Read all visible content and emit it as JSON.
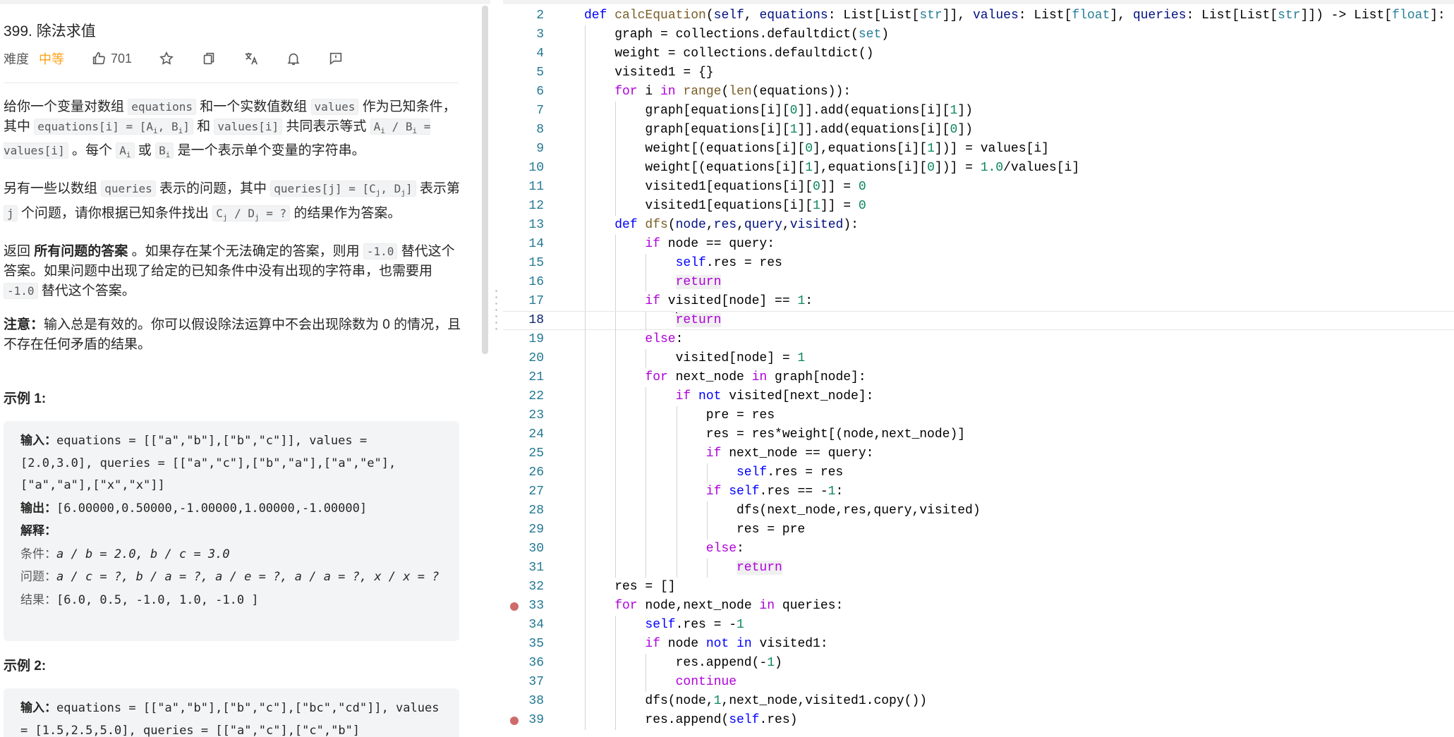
{
  "problem": {
    "title": "399. 除法求值",
    "difficulty_label": "难度",
    "difficulty": "中等",
    "likes": "701",
    "difficulty_color": "#ffa116",
    "icons": [
      "thumb-up-icon",
      "star-icon",
      "share-icon",
      "translate-icon",
      "bell-icon",
      "feedback-icon"
    ]
  },
  "description": {
    "p1_a": "给你一个变量对数组 ",
    "p1_code1": "equations",
    "p1_b": " 和一个实数值数组 ",
    "p1_code2": "values",
    "p1_c": " 作为已知条件，其中 ",
    "p1_code3": "equations[i] = [A",
    "p1_code3_sub1": "i",
    "p1_code3_mid": ", B",
    "p1_code3_sub2": "i",
    "p1_code3_end": "]",
    "p1_d": " 和 ",
    "p1_code4": "values[i]",
    "p1_e": " 共同表示等式 ",
    "p1_code5": "A",
    "p1_code5_sub": "i",
    "p1_code5_end": " / B",
    "p1_code5_sub2": "i",
    "p1_code5_tail": " = values[i]",
    "p1_f": " 。每个 ",
    "p1_code6": "A",
    "p1_code6_sub": "i",
    "p1_g": " 或 ",
    "p1_code7": "B",
    "p1_code7_sub": "i",
    "p1_h": " 是一个表示单个变量的字符串。",
    "p2_a": "另有一些以数组 ",
    "p2_code1": "queries",
    "p2_b": " 表示的问题，其中 ",
    "p2_code2": "queries[j] = [C",
    "p2_code2_sub1": "j",
    "p2_code2_mid": ", D",
    "p2_code2_sub2": "j",
    "p2_code2_end": "]",
    "p2_c": " 表示第 ",
    "p2_code3": "j",
    "p2_d": " 个问题，请你根据已知条件找出 ",
    "p2_code4": "C",
    "p2_code4_sub": "j",
    "p2_code4_mid": " / D",
    "p2_code4_sub2": "j",
    "p2_code4_end": " = ?",
    "p2_e": " 的结果作为答案。",
    "p3_a": "返回 ",
    "p3_bold": "所有问题的答案",
    "p3_b": " 。如果存在某个无法确定的答案，则用 ",
    "p3_code1": "-1.0",
    "p3_c": " 替代这个答案。如果问题中出现了给定的已知条件中没有出现的字符串，也需要用 ",
    "p3_code2": "-1.0",
    "p3_d": " 替代这个答案。",
    "p4_bold": "注意：",
    "p4_text": "输入总是有效的。你可以假设除法运算中不会出现除数为 0 的情况，且不存在任何矛盾的结果。"
  },
  "examples": [
    {
      "title": "示例 1:",
      "input_label": "输入：",
      "input": "equations = [[\"a\",\"b\"],[\"b\",\"c\"]], values = [2.0,3.0], queries = [[\"a\",\"c\"],[\"b\",\"a\"],[\"a\",\"e\"],[\"a\",\"a\"],[\"x\",\"x\"]]",
      "output_label": "输出：",
      "output": "[6.00000,0.50000,-1.00000,1.00000,-1.00000]",
      "explain_label": "解释：",
      "cond_label": "条件：",
      "cond": "a / b = 2.0, b / c = 3.0",
      "q_label": "问题：",
      "q": "a / c = ?, b / a = ?, a / e = ?, a / a = ?, x / x = ?",
      "res_label": "结果：",
      "res": "[6.0, 0.5, -1.0, 1.0, -1.0 ]"
    },
    {
      "title": "示例 2:",
      "input_label": "输入：",
      "input": "equations = [[\"a\",\"b\"],[\"b\",\"c\"],[\"bc\",\"cd\"]], values = [1.5,2.5,5.0], queries = [[\"a\",\"c\"],[\"c\",\"b\"]"
    }
  ],
  "editor": {
    "active_line": 18,
    "breakpoints": [
      33,
      39
    ],
    "lines": [
      {
        "n": 2,
        "indent": 1,
        "html": "<span class='kd'>def</span> <span class='fn'>calcEquation</span>(<span class='pr'>self</span>, <span class='pr'>equations</span>: List[List[<span class='bi'>str</span>]], <span class='pr'>values</span>: List[<span class='bi'>float</span>], <span class='pr'>queries</span>: List[List[<span class='bi'>str</span>]]) -> List[<span class='bi'>float</span>]:"
      },
      {
        "n": 3,
        "indent": 2,
        "html": "graph = collections.defaultdict(<span class='bi'>set</span>)"
      },
      {
        "n": 4,
        "indent": 2,
        "html": "weight = collections.defaultdict()"
      },
      {
        "n": 5,
        "indent": 2,
        "html": "visited1 = {}"
      },
      {
        "n": 6,
        "indent": 2,
        "html": "<span class='kw'>for</span> i <span class='kw'>in</span> <span class='fn'>range</span>(<span class='fn'>len</span>(equations)):"
      },
      {
        "n": 7,
        "indent": 3,
        "html": "graph[equations[i][<span class='nm'>0</span>]].add(equations[i][<span class='nm'>1</span>])"
      },
      {
        "n": 8,
        "indent": 3,
        "html": "graph[equations[i][<span class='nm'>1</span>]].add(equations[i][<span class='nm'>0</span>])"
      },
      {
        "n": 9,
        "indent": 3,
        "html": "weight[(equations[i][<span class='nm'>0</span>],equations[i][<span class='nm'>1</span>])] = values[i]"
      },
      {
        "n": 10,
        "indent": 3,
        "html": "weight[(equations[i][<span class='nm'>1</span>],equations[i][<span class='nm'>0</span>])] = <span class='nm'>1.0</span>/values[i]"
      },
      {
        "n": 11,
        "indent": 3,
        "html": "visited1[equations[i][<span class='nm'>0</span>]] = <span class='nm'>0</span>"
      },
      {
        "n": 12,
        "indent": 3,
        "html": "visited1[equations[i][<span class='nm'>1</span>]] = <span class='nm'>0</span>"
      },
      {
        "n": 13,
        "indent": 2,
        "html": "<span class='kd'>def</span> <span class='fn'>dfs</span>(<span class='pr'>node</span>,<span class='pr'>res</span>,<span class='pr'>query</span>,<span class='pr'>visited</span>):"
      },
      {
        "n": 14,
        "indent": 3,
        "html": "<span class='kw'>if</span> node == query:"
      },
      {
        "n": 15,
        "indent": 4,
        "html": "<span class='sf'>self</span>.res = res"
      },
      {
        "n": 16,
        "indent": 4,
        "html": "<span class='kw ret'>return</span>"
      },
      {
        "n": 17,
        "indent": 3,
        "html": "<span class='kw'>if</span> visited[node] == <span class='nm'>1</span>:"
      },
      {
        "n": 18,
        "indent": 4,
        "html": "<span class='cursor'></span><span class='kw ret'>return</span>"
      },
      {
        "n": 19,
        "indent": 3,
        "html": "<span class='kw'>else</span>:"
      },
      {
        "n": 20,
        "indent": 4,
        "html": "visited[node] = <span class='nm'>1</span>"
      },
      {
        "n": 21,
        "indent": 3,
        "html": "<span class='kw'>for</span> next_node <span class='kw'>in</span> graph[node]:"
      },
      {
        "n": 22,
        "indent": 4,
        "html": "<span class='kw'>if</span> <span class='kd'>not</span> visited[next_node]:"
      },
      {
        "n": 23,
        "indent": 5,
        "html": "pre = res"
      },
      {
        "n": 24,
        "indent": 5,
        "html": "res = res*weight[(node,next_node)]"
      },
      {
        "n": 25,
        "indent": 5,
        "html": "<span class='kw'>if</span> next_node == query:"
      },
      {
        "n": 26,
        "indent": 6,
        "html": "<span class='sf'>self</span>.res = res"
      },
      {
        "n": 27,
        "indent": 5,
        "html": "<span class='kw'>if</span> <span class='sf'>self</span>.res == -<span class='nm'>1</span>:"
      },
      {
        "n": 28,
        "indent": 6,
        "html": "dfs(next_node,res,query,visited)"
      },
      {
        "n": 29,
        "indent": 6,
        "html": "res = pre"
      },
      {
        "n": 30,
        "indent": 5,
        "html": "<span class='kw'>else</span>:"
      },
      {
        "n": 31,
        "indent": 6,
        "html": "<span class='kw ret'>return</span>"
      },
      {
        "n": 32,
        "indent": 2,
        "html": "res = []"
      },
      {
        "n": 33,
        "indent": 2,
        "html": "<span class='kw'>for</span> node,next_node <span class='kw'>in</span> queries:"
      },
      {
        "n": 34,
        "indent": 3,
        "html": "<span class='sf'>self</span>.res = -<span class='nm'>1</span>"
      },
      {
        "n": 35,
        "indent": 3,
        "html": "<span class='kw'>if</span> node <span class='kd'>not</span> <span class='kd'>in</span> visited1:"
      },
      {
        "n": 36,
        "indent": 4,
        "html": "res.append(-<span class='nm'>1</span>)"
      },
      {
        "n": 37,
        "indent": 4,
        "html": "<span class='kw'>continue</span>"
      },
      {
        "n": 38,
        "indent": 3,
        "html": "dfs(node,<span class='nm'>1</span>,next_node,visited1.copy())"
      },
      {
        "n": 39,
        "indent": 3,
        "html": "res.append(<span class='sf'>self</span>.res)"
      }
    ]
  }
}
